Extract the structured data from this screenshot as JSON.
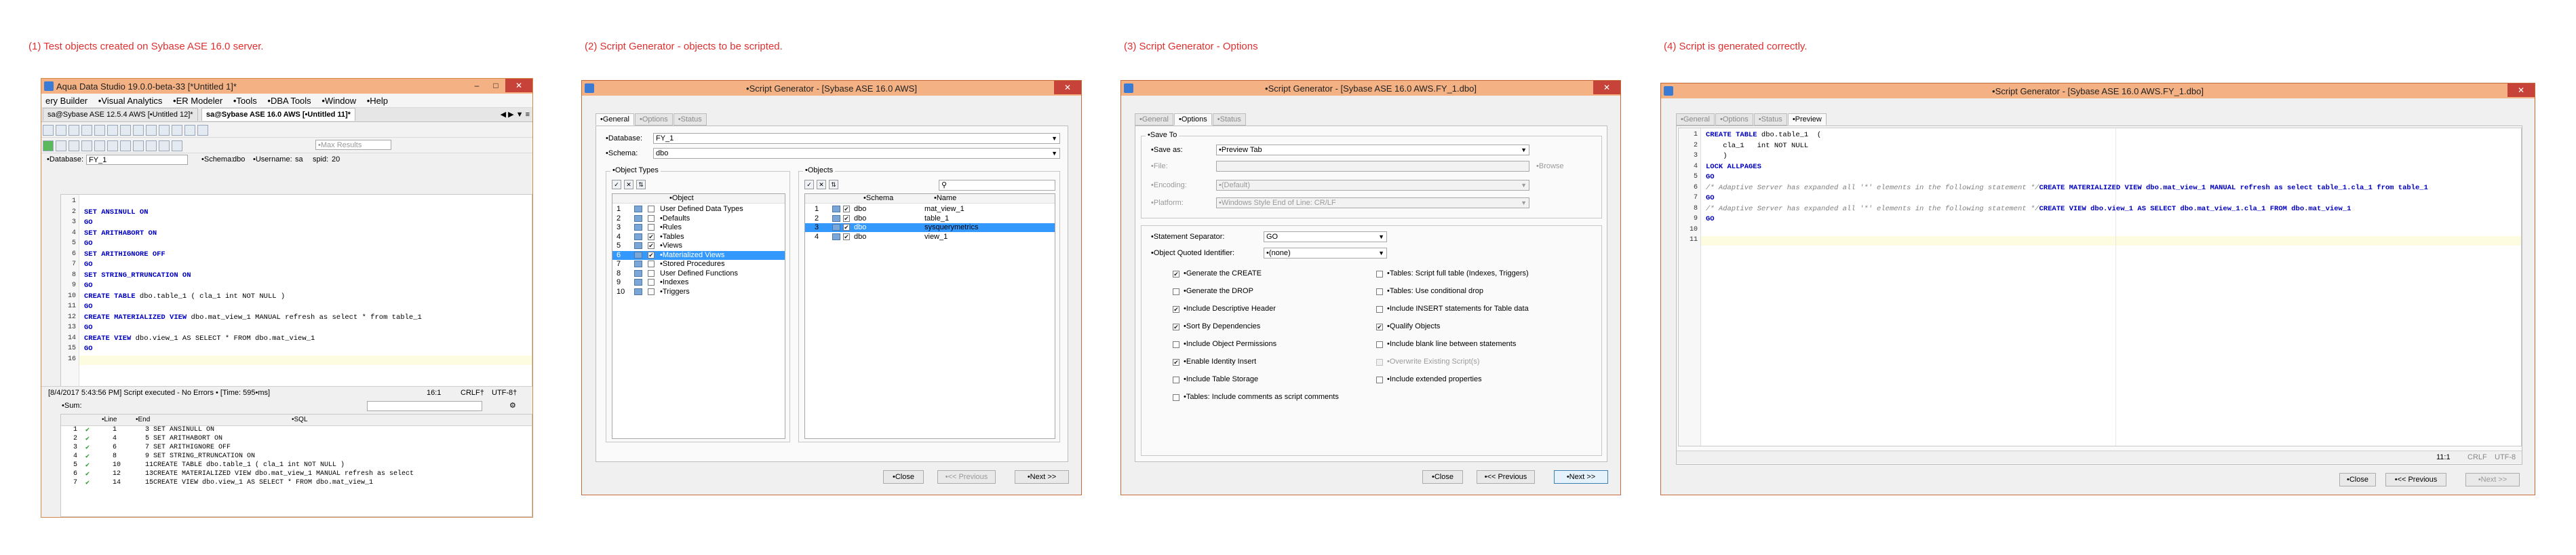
{
  "captions": [
    "(1)  Test objects created on Sybase ASE 16.0 server.",
    "(2)  Script Generator - objects to be scripted.",
    "(3)  Script Generator - Options",
    "(4)  Script is generated correctly."
  ],
  "panel1": {
    "title": "Aqua Data Studio 19.0.0-beta-33 [*Untitled 1]*",
    "menu": [
      "ery Builder",
      "•Visual Analytics",
      "•ER Modeler",
      "•Tools",
      "•DBA Tools",
      "•Window",
      "•Help"
    ],
    "tabs": [
      "sa@Sybase ASE 12.5.4 AWS [•Untitled 12]*",
      "sa@Sybase ASE 16.0 AWS [•Untitled 11]*"
    ],
    "max_results_placeholder": "•Max Results",
    "database_label": "•Database:",
    "database_value": "FY_1",
    "schema_label": "•Schema:",
    "schema_value": "dbo",
    "username_label": "•Username:",
    "username_value": "sa",
    "spid_label": "spid:",
    "spid_value": "20",
    "line_numbers": [
      "1",
      "2",
      "3",
      "4",
      "5",
      "6",
      "7",
      "8",
      "9",
      "10",
      "11",
      "12",
      "13",
      "14",
      "15",
      "16"
    ],
    "code": [
      {
        "kw": "",
        "rest": ""
      },
      {
        "kw": "SET ANSINULL ON",
        "rest": ""
      },
      {
        "kw": "GO",
        "rest": ""
      },
      {
        "kw": "SET ARITHABORT ON",
        "rest": ""
      },
      {
        "kw": "GO",
        "rest": ""
      },
      {
        "kw": "SET ARITHIGNORE OFF",
        "rest": ""
      },
      {
        "kw": "GO",
        "rest": ""
      },
      {
        "kw": "SET STRING_RTRUNCATION ON",
        "rest": ""
      },
      {
        "kw": "GO",
        "rest": ""
      },
      {
        "kw": "CREATE TABLE",
        "rest": " dbo.table_1 ( cla_1 int NOT NULL )"
      },
      {
        "kw": "GO",
        "rest": ""
      },
      {
        "kw": "CREATE MATERIALIZED VIEW",
        "rest": " dbo.mat_view_1 MANUAL refresh as select * from table_1"
      },
      {
        "kw": "GO",
        "rest": ""
      },
      {
        "kw": "CREATE VIEW",
        "rest": " dbo.view_1 AS SELECT * FROM dbo.mat_view_1"
      },
      {
        "kw": "GO",
        "rest": ""
      },
      {
        "kw": "",
        "rest": ""
      }
    ],
    "status_msg": "[8/4/2017 5:43:56 PM] Script executed - No Errors • [Time: 595•ms]",
    "status_pos": "16:1",
    "status_eol": "CRLF†",
    "status_enc": "UTF-8†",
    "sum_label": "•Sum:",
    "grid_headers": [
      "•Line",
      "•End",
      "•SQL"
    ],
    "grid_rows": [
      [
        "1",
        "1",
        "3",
        "SET ANSINULL ON"
      ],
      [
        "2",
        "4",
        "5",
        "SET ARITHABORT ON"
      ],
      [
        "3",
        "6",
        "7",
        "SET ARITHIGNORE OFF"
      ],
      [
        "4",
        "8",
        "9",
        "SET STRING_RTRUNCATION ON"
      ],
      [
        "5",
        "10",
        "11",
        "CREATE TABLE dbo.table_1 ( cla_1 int NOT NULL )"
      ],
      [
        "6",
        "12",
        "13",
        "CREATE MATERIALIZED VIEW dbo.mat_view_1 MANUAL refresh as select"
      ],
      [
        "7",
        "14",
        "15",
        "CREATE VIEW dbo.view_1 AS SELECT * FROM dbo.mat_view_1"
      ]
    ]
  },
  "panel2": {
    "title": "•Script Generator - [Sybase ASE 16.0 AWS]",
    "tabs": [
      "•General",
      "•Options",
      "•Status"
    ],
    "database_label": "•Database:",
    "database_value": "FY_1",
    "schema_label": "•Schema:",
    "schema_value": "dbo",
    "object_types_title": "•Object Types",
    "object_header": "•Object",
    "object_types": [
      {
        "n": "1",
        "checked": false,
        "name": "User Defined Data Types",
        "sel": false
      },
      {
        "n": "2",
        "checked": false,
        "name": "•Defaults",
        "sel": false
      },
      {
        "n": "3",
        "checked": false,
        "name": "•Rules",
        "sel": false
      },
      {
        "n": "4",
        "checked": true,
        "name": "•Tables",
        "sel": false
      },
      {
        "n": "5",
        "checked": true,
        "name": "•Views",
        "sel": false
      },
      {
        "n": "6",
        "checked": true,
        "name": "•Materialized Views",
        "sel": true
      },
      {
        "n": "7",
        "checked": false,
        "name": "•Stored Procedures",
        "sel": false
      },
      {
        "n": "8",
        "checked": false,
        "name": "User Defined Functions",
        "sel": false
      },
      {
        "n": "9",
        "checked": false,
        "name": "•Indexes",
        "sel": false
      },
      {
        "n": "10",
        "checked": false,
        "name": "•Triggers",
        "sel": false
      }
    ],
    "objects_title": "•Objects",
    "objects_headers": [
      "•Schema",
      "•Name"
    ],
    "objects": [
      {
        "n": "1",
        "schema": "dbo",
        "name": "mat_view_1",
        "sel": false
      },
      {
        "n": "2",
        "schema": "dbo",
        "name": "table_1",
        "sel": false
      },
      {
        "n": "3",
        "schema": "dbo",
        "name": "sysquerymetrics",
        "sel": true
      },
      {
        "n": "4",
        "schema": "dbo",
        "name": "view_1",
        "sel": false
      }
    ],
    "close_label": "•Close",
    "prev_label": "•<< Previous",
    "next_label": "•Next >>"
  },
  "panel3": {
    "title": "•Script Generator - [Sybase ASE 16.0 AWS.FY_1.dbo]",
    "tabs": [
      "•General",
      "•Options",
      "•Status"
    ],
    "save_to_title": "•Save To",
    "save_as_label": "•Save as:",
    "save_as_value": "•Preview Tab",
    "file_label": "•File:",
    "browse_label": "•Browse",
    "encoding_label": "•Encoding:",
    "encoding_value": "•(Default)",
    "platform_label": "•Platform:",
    "platform_value": "•Windows Style End of Line: CR/LF",
    "stmt_sep_label": "•Statement Separator:",
    "stmt_sep_value": "GO",
    "quoted_label": "•Object Quoted Identifier:",
    "quoted_value": "•(none)",
    "options_left": [
      {
        "checked": true,
        "label": "•Generate the CREATE",
        "dis": false
      },
      {
        "checked": false,
        "label": "•Generate the DROP",
        "dis": false
      },
      {
        "checked": true,
        "label": "•Include Descriptive Header",
        "dis": false
      },
      {
        "checked": true,
        "label": "•Sort By Dependencies",
        "dis": false
      },
      {
        "checked": false,
        "label": "•Include Object Permissions",
        "dis": false
      },
      {
        "checked": true,
        "label": "•Enable Identity Insert",
        "dis": false
      },
      {
        "checked": false,
        "label": "•Include Table Storage",
        "dis": false
      },
      {
        "checked": false,
        "label": "•Tables: Include comments as script comments",
        "dis": false
      }
    ],
    "options_right": [
      {
        "checked": false,
        "label": "•Tables: Script full table (Indexes, Triggers)",
        "dis": false
      },
      {
        "checked": false,
        "label": "•Tables: Use conditional drop",
        "dis": false
      },
      {
        "checked": false,
        "label": "•Include INSERT statements for Table data",
        "dis": false
      },
      {
        "checked": true,
        "label": "•Qualify Objects",
        "dis": false
      },
      {
        "checked": false,
        "label": "•Include blank line between statements",
        "dis": false
      },
      {
        "checked": false,
        "label": "•Overwrite Existing Script(s)",
        "dis": true
      },
      {
        "checked": false,
        "label": "•Include extended properties",
        "dis": false
      }
    ],
    "close_label": "•Close",
    "prev_label": "•<< Previous",
    "next_label": "•Next >>"
  },
  "panel4": {
    "title": "•Script Generator - [Sybase ASE 16.0 AWS.FY_1.dbo]",
    "tabs": [
      "•General",
      "•Options",
      "•Status",
      "•Preview"
    ],
    "line_numbers": [
      "1",
      "2",
      "3",
      "4",
      "5",
      "6",
      "7",
      "8",
      "9",
      "10",
      "11"
    ],
    "code": [
      {
        "cls": "kw",
        "a": "CREATE TABLE",
        "b": " dbo.table_1  ("
      },
      {
        "cls": "",
        "a": "",
        "b": "    cla_1   int NOT NULL"
      },
      {
        "cls": "",
        "a": "",
        "b": "    )"
      },
      {
        "cls": "kw",
        "a": "LOCK ALLPAGES",
        "b": ""
      },
      {
        "cls": "kw",
        "a": "GO",
        "b": ""
      },
      {
        "cls": "cm",
        "a": "/* Adaptive Server has expanded all '*' elements in the following statement */",
        "b": "CREATE MATERIALIZED VIEW dbo.mat_view_1 MANUAL refresh as select table_1.cla_1 from table_1"
      },
      {
        "cls": "kw",
        "a": "GO",
        "b": ""
      },
      {
        "cls": "cm",
        "a": "/* Adaptive Server has expanded all '*' elements in the following statement */",
        "b": "CREATE VIEW dbo.view_1 AS SELECT dbo.mat_view_1.cla_1 FROM dbo.mat_view_1"
      },
      {
        "cls": "kw",
        "a": "GO",
        "b": ""
      },
      {
        "cls": "",
        "a": "",
        "b": ""
      },
      {
        "cls": "",
        "a": "",
        "b": ""
      }
    ],
    "status_pos": "11:1",
    "status_eol": "CRLF",
    "status_enc": "UTF-8",
    "close_label": "•Close",
    "prev_label": "•<< Previous",
    "next_label": "•Next >>"
  }
}
